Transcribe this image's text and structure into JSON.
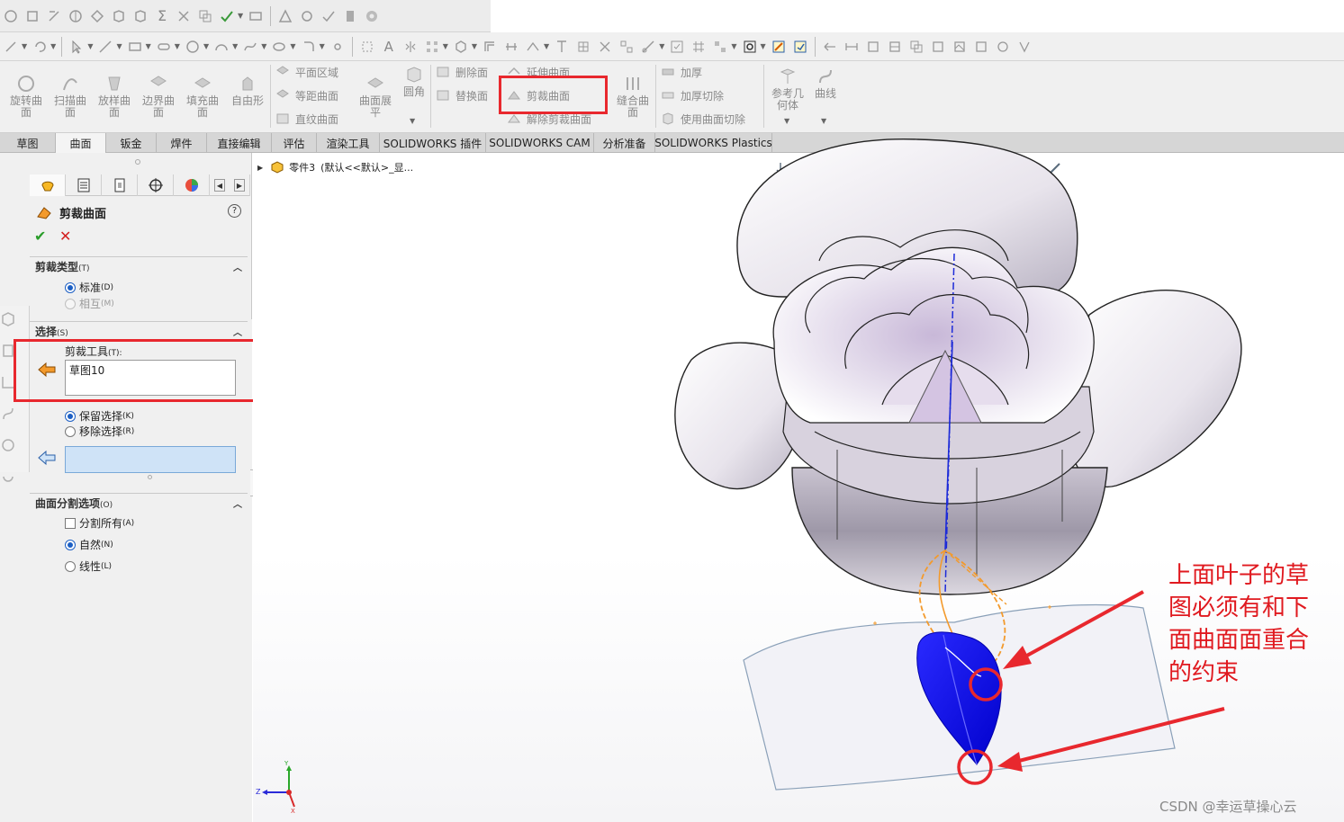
{
  "quick_access": {
    "icons": [
      "rebuild-icon",
      "options-icon",
      "sketch-icon",
      "smart-dimension-icon",
      "mate-icon",
      "feature-icon",
      "assembly-icon",
      "sum-icon",
      "tools-icon",
      "copy-icon",
      "check-icon",
      "eraser-icon",
      "section-icon",
      "view-icon",
      "display-icon",
      "stop-icon",
      "gear-icon"
    ]
  },
  "ribbon": {
    "large_buttons": [
      {
        "label": "旋转曲\n面",
        "icon": "revolve-surface-icon"
      },
      {
        "label": "扫描曲\n面",
        "icon": "sweep-surface-icon"
      },
      {
        "label": "放样曲\n面",
        "icon": "loft-surface-icon"
      },
      {
        "label": "边界曲\n面",
        "icon": "boundary-surface-icon"
      },
      {
        "label": "填充曲\n面",
        "icon": "fill-surface-icon"
      },
      {
        "label": "自由形",
        "icon": "freeform-icon"
      }
    ],
    "planar_group": [
      "平面区域",
      "等距曲面",
      "直纹曲面"
    ],
    "flatten_label": "曲面展\n平",
    "fillet_label": "圆角",
    "delete_group": [
      "删除面",
      "替换面"
    ],
    "extend_group": [
      "延伸曲面",
      "剪裁曲面",
      "解除剪裁曲面"
    ],
    "knit_label": "缝合曲\n面",
    "thicken_group": [
      "加厚",
      "加厚切除",
      "使用曲面切除"
    ],
    "ref_geometry_label": "参考几\n何体",
    "curves_label": "曲线"
  },
  "tabs": [
    {
      "label": "草图",
      "active": false
    },
    {
      "label": "曲面",
      "active": true
    },
    {
      "label": "钣金",
      "active": false
    },
    {
      "label": "焊件",
      "active": false
    },
    {
      "label": "直接编辑",
      "active": false
    },
    {
      "label": "评估",
      "active": false
    },
    {
      "label": "渲染工具",
      "active": false
    },
    {
      "label": "SOLIDWORKS 插件",
      "active": false
    },
    {
      "label": "SOLIDWORKS CAM",
      "active": false
    },
    {
      "label": "分析准备",
      "active": false
    },
    {
      "label": "SOLIDWORKS Plastics",
      "active": false
    }
  ],
  "property_manager": {
    "title": "剪裁曲面",
    "help": "?",
    "trim_type": {
      "header": "剪裁类型",
      "header_key": "(T)",
      "standard": "标准",
      "standard_key": "(D)",
      "mutual": "相互",
      "mutual_key": "(M)"
    },
    "selections": {
      "header": "选择",
      "header_key": "(S)",
      "trim_tool_label": "剪裁工具",
      "trim_tool_key": "(T):",
      "trim_tool_value": "草图10",
      "keep": "保留选择",
      "keep_key": "(K)",
      "remove": "移除选择",
      "remove_key": "(R)"
    },
    "split_options": {
      "header": "曲面分割选项",
      "header_key": "(O)",
      "split_all": "分割所有",
      "split_all_key": "(A)",
      "natural": "自然",
      "natural_key": "(N)",
      "linear": "线性",
      "linear_key": "(L)"
    }
  },
  "tree": {
    "part_name": "零件3",
    "config": "(默认<<默认>_显..."
  },
  "annotation": "上面叶子的草图必须有和下面曲面面重合的约束",
  "watermark": "CSDN @幸运草操心云",
  "triad": {
    "y": "Y",
    "z": "Z",
    "x": "X"
  },
  "colors": {
    "highlight_red": "#e8282e",
    "surface_blue": "#1a1aff",
    "sketch_orange": "#f39a2c",
    "axis_blue": "#1d2bd8"
  }
}
